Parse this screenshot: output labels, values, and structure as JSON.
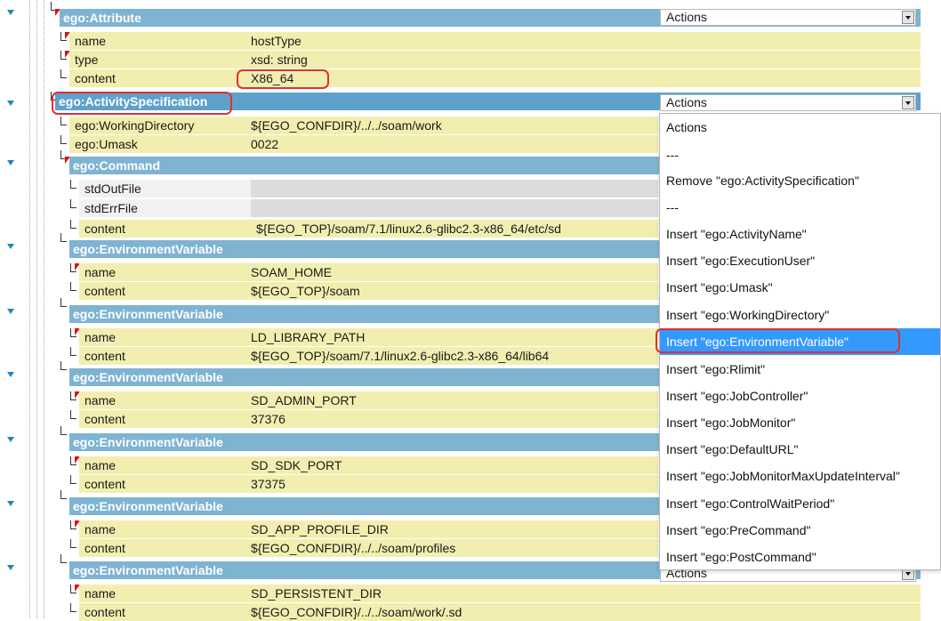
{
  "actions_label": "Actions",
  "tree": {
    "attribute": {
      "label": "ego:Attribute",
      "rows": [
        {
          "name": "name",
          "value": "hostType"
        },
        {
          "name": "type",
          "value": "xsd: string"
        },
        {
          "name": "content",
          "value": "X86_64"
        }
      ]
    },
    "activity_spec": {
      "label": "ego:ActivitySpecification",
      "rows": [
        {
          "name": "ego:WorkingDirectory",
          "value": "${EGO_CONFDIR}/../../soam/work"
        },
        {
          "name": "ego:Umask",
          "value": "0022"
        }
      ]
    },
    "command": {
      "label": "ego:Command",
      "rows": [
        {
          "name": "stdOutFile",
          "value": ""
        },
        {
          "name": "stdErrFile",
          "value": ""
        },
        {
          "name": "content",
          "value": "${EGO_TOP}/soam/7.1/linux2.6-glibc2.3-x86_64/etc/sd"
        }
      ]
    },
    "env_vars": [
      {
        "label": "ego:EnvironmentVariable",
        "name_label": "name",
        "name_value": "SOAM_HOME",
        "content_label": "content",
        "content_value": "${EGO_TOP}/soam"
      },
      {
        "label": "ego:EnvironmentVariable",
        "name_label": "name",
        "name_value": "LD_LIBRARY_PATH",
        "content_label": "content",
        "content_value": "${EGO_TOP}/soam/7.1/linux2.6-glibc2.3-x86_64/lib64"
      },
      {
        "label": "ego:EnvironmentVariable",
        "name_label": "name",
        "name_value": "SD_ADMIN_PORT",
        "content_label": "content",
        "content_value": "37376"
      },
      {
        "label": "ego:EnvironmentVariable",
        "name_label": "name",
        "name_value": "SD_SDK_PORT",
        "content_label": "content",
        "content_value": "37375"
      },
      {
        "label": "ego:EnvironmentVariable",
        "name_label": "name",
        "name_value": "SD_APP_PROFILE_DIR",
        "content_label": "content",
        "content_value": "${EGO_CONFDIR}/../../soam/profiles"
      },
      {
        "label": "ego:EnvironmentVariable",
        "name_label": "name",
        "name_value": "SD_PERSISTENT_DIR",
        "content_label": "content",
        "content_value": "${EGO_CONFDIR}/../../soam/work/.sd"
      }
    ]
  },
  "dropdown": {
    "items": [
      "Actions",
      "---",
      "Remove \"ego:ActivitySpecification\"",
      "---",
      "Insert \"ego:ActivityName\"",
      "Insert \"ego:ExecutionUser\"",
      "Insert \"ego:Umask\"",
      "Insert \"ego:WorkingDirectory\"",
      "Insert \"ego:EnvironmentVariable\"",
      "Insert \"ego:Rlimit\"",
      "Insert \"ego:JobController\"",
      "Insert \"ego:JobMonitor\"",
      "Insert \"ego:DefaultURL\"",
      "Insert \"ego:JobMonitorMaxUpdateInterval\"",
      "Insert \"ego:ControlWaitPeriod\"",
      "Insert \"ego:PreCommand\"",
      "Insert \"ego:PostCommand\""
    ],
    "highlighted_item": "Insert \"ego:EnvironmentVariable\""
  },
  "colors": {
    "header_bg": "#7fb3d2",
    "name_value_bg": "#f2eeb0",
    "selection_bg": "#3399ff",
    "annotation": "#e03030"
  }
}
